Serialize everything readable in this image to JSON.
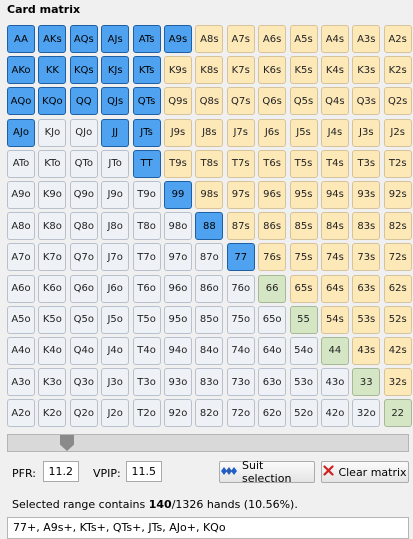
{
  "title": "Card matrix",
  "grid": {
    "rows": [
      [
        "AA",
        "AKs",
        "AQs",
        "AJs",
        "ATs",
        "A9s",
        "A8s",
        "A7s",
        "A6s",
        "A5s",
        "A4s",
        "A3s",
        "A2s"
      ],
      [
        "AKo",
        "KK",
        "KQs",
        "KJs",
        "KTs",
        "K9s",
        "K8s",
        "K7s",
        "K6s",
        "K5s",
        "K4s",
        "K3s",
        "K2s"
      ],
      [
        "AQo",
        "KQo",
        "QQ",
        "QJs",
        "QTs",
        "Q9s",
        "Q8s",
        "Q7s",
        "Q6s",
        "Q5s",
        "Q4s",
        "Q3s",
        "Q2s"
      ],
      [
        "AJo",
        "KJo",
        "QJo",
        "JJ",
        "JTs",
        "J9s",
        "J8s",
        "J7s",
        "J6s",
        "J5s",
        "J4s",
        "J3s",
        "J2s"
      ],
      [
        "ATo",
        "KTo",
        "QTo",
        "JTo",
        "TT",
        "T9s",
        "T8s",
        "T7s",
        "T6s",
        "T5s",
        "T4s",
        "T3s",
        "T2s"
      ],
      [
        "A9o",
        "K9o",
        "Q9o",
        "J9o",
        "T9o",
        "99",
        "98s",
        "97s",
        "96s",
        "95s",
        "94s",
        "93s",
        "92s"
      ],
      [
        "A8o",
        "K8o",
        "Q8o",
        "J8o",
        "T8o",
        "98o",
        "88",
        "87s",
        "86s",
        "85s",
        "84s",
        "83s",
        "82s"
      ],
      [
        "A7o",
        "K7o",
        "Q7o",
        "J7o",
        "T7o",
        "97o",
        "87o",
        "77",
        "76s",
        "75s",
        "74s",
        "73s",
        "72s"
      ],
      [
        "A6o",
        "K6o",
        "Q6o",
        "J6o",
        "T6o",
        "96o",
        "86o",
        "76o",
        "66",
        "65s",
        "64s",
        "63s",
        "62s"
      ],
      [
        "A5o",
        "K5o",
        "Q5o",
        "J5o",
        "T5o",
        "95o",
        "85o",
        "75o",
        "65o",
        "55",
        "54s",
        "53s",
        "52s"
      ],
      [
        "A4o",
        "K4o",
        "Q4o",
        "J4o",
        "T4o",
        "94o",
        "84o",
        "74o",
        "64o",
        "54o",
        "44",
        "43s",
        "42s"
      ],
      [
        "A3o",
        "K3o",
        "Q3o",
        "J3o",
        "T3o",
        "93o",
        "83o",
        "73o",
        "63o",
        "53o",
        "43o",
        "33",
        "32s"
      ],
      [
        "A2o",
        "K2o",
        "Q2o",
        "J2o",
        "T2o",
        "92o",
        "82o",
        "72o",
        "62o",
        "52o",
        "42o",
        "32o",
        "22"
      ]
    ],
    "selected": [
      "AA",
      "AKs",
      "AQs",
      "AJs",
      "ATs",
      "A9s",
      "AKo",
      "KK",
      "KQs",
      "KJs",
      "KTs",
      "AQo",
      "KQo",
      "QQ",
      "QJs",
      "QTs",
      "AJo",
      "JJ",
      "JTs",
      "TT",
      "99",
      "88",
      "77"
    ]
  },
  "colors": {
    "selected": "#4ea2f0",
    "suited": "#fde8b8",
    "offsuit": "#eef2f7",
    "pair": "#d5e6c4"
  },
  "slider": {
    "value_fraction": 0.13
  },
  "pfr": {
    "label": "PFR:",
    "value": "11.2"
  },
  "vpip": {
    "label": "VPIP:",
    "value": "11.5"
  },
  "buttons": {
    "suit_selection": "Suit selection",
    "clear_matrix": "Clear matrix"
  },
  "status": {
    "prefix": "Selected range contains ",
    "count": "140",
    "suffix": "/1326 hands (10.56%)."
  },
  "range_text": "77+, A9s+, KTs+, QTs+, JTs, AJo+, KQo"
}
